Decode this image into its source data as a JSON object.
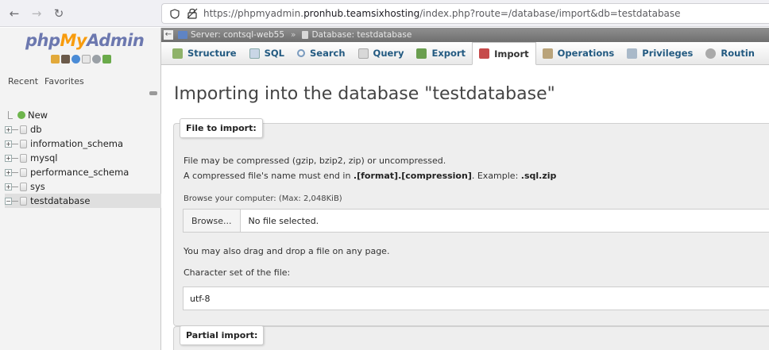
{
  "browser": {
    "url_prefix": "https://phpmyadmin.",
    "url_domain": "pronhub.teamsixhosting",
    "url_suffix": "/index.php?route=/database/import&db=testdatabase"
  },
  "sidebar": {
    "logo_php": "php",
    "logo_my": "My",
    "logo_admin": "Admin",
    "recent_label": "Recent",
    "favorites_label": "Favorites",
    "tree": [
      {
        "label": "New"
      },
      {
        "label": "db"
      },
      {
        "label": "information_schema"
      },
      {
        "label": "mysql"
      },
      {
        "label": "performance_schema"
      },
      {
        "label": "sys"
      },
      {
        "label": "testdatabase"
      }
    ]
  },
  "breadcrumb": {
    "server": "Server: contsql-web55",
    "sep": "»",
    "database": "Database: testdatabase"
  },
  "tabs": [
    {
      "label": "Structure"
    },
    {
      "label": "SQL"
    },
    {
      "label": "Search"
    },
    {
      "label": "Query"
    },
    {
      "label": "Export"
    },
    {
      "label": "Import"
    },
    {
      "label": "Operations"
    },
    {
      "label": "Privileges"
    },
    {
      "label": "Routin"
    }
  ],
  "main": {
    "title": "Importing into the database \"testdatabase\"",
    "file_legend": "File to import:",
    "compress_line1": "File may be compressed (gzip, bzip2, zip) or uncompressed.",
    "compress_line2_a": "A compressed file's name must end in ",
    "compress_line2_b": ".[format].[compression]",
    "compress_line2_c": ". Example: ",
    "compress_line2_d": ".sql.zip",
    "browse_label": "Browse your computer: (Max: 2,048KiB)",
    "browse_button": "Browse...",
    "no_file": "No file selected.",
    "drag_drop": "You may also drag and drop a file on any page.",
    "charset_label": "Character set of the file:",
    "charset_value": "utf-8",
    "partial_legend": "Partial import:"
  }
}
